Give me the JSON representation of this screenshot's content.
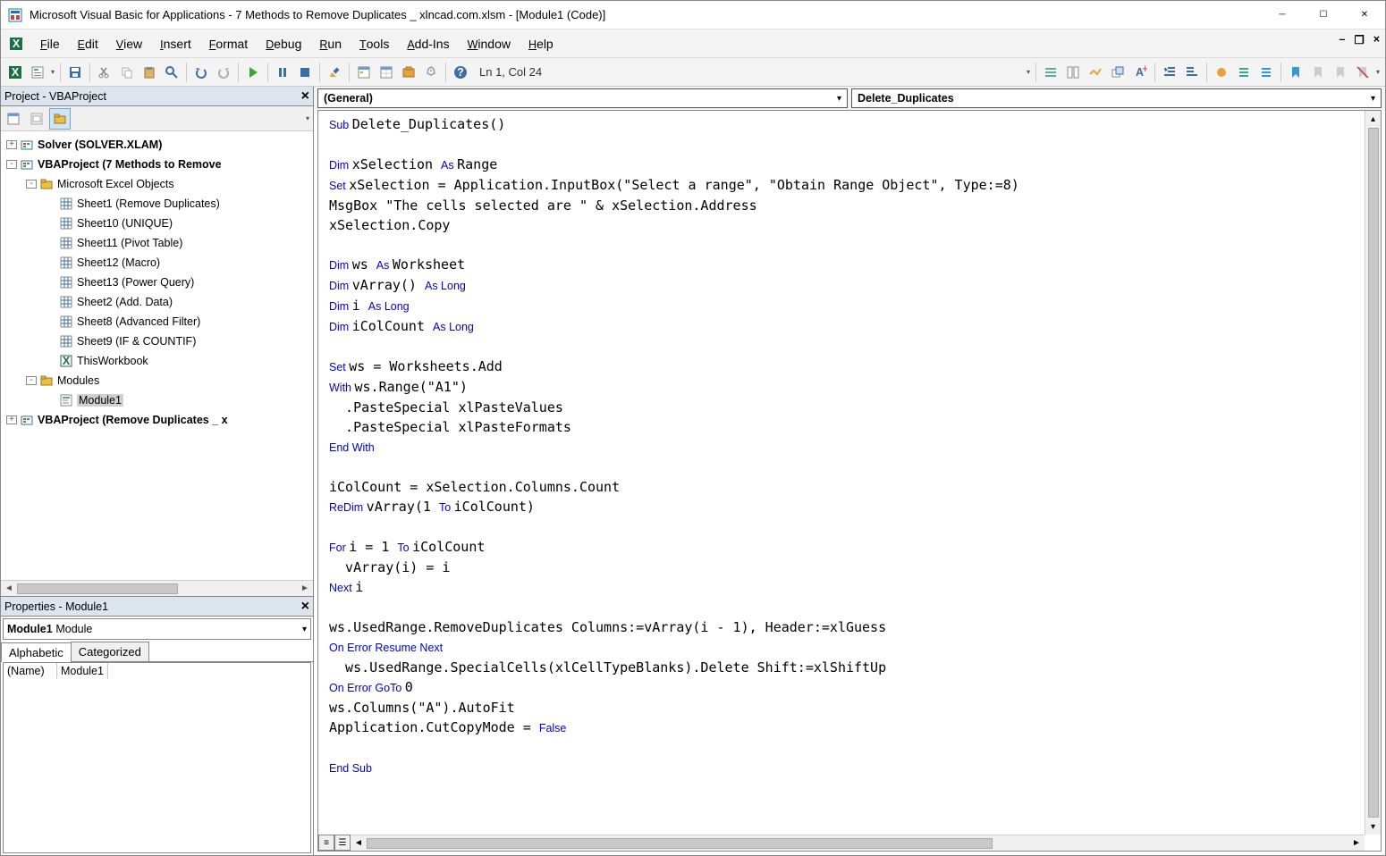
{
  "title": "Microsoft Visual Basic for Applications - 7 Methods to Remove Duplicates _ xlncad.com.xlsm - [Module1 (Code)]",
  "menu": [
    "File",
    "Edit",
    "View",
    "Insert",
    "Format",
    "Debug",
    "Run",
    "Tools",
    "Add-Ins",
    "Window",
    "Help"
  ],
  "status": "Ln 1, Col 24",
  "project": {
    "title": "Project - VBAProject",
    "nodes": [
      {
        "depth": 0,
        "toggle": "+",
        "icon": "proj",
        "label": "Solver (SOLVER.XLAM)",
        "bold": true
      },
      {
        "depth": 0,
        "toggle": "-",
        "icon": "proj",
        "label": "VBAProject (7 Methods to Remove",
        "bold": true
      },
      {
        "depth": 1,
        "toggle": "-",
        "icon": "folder",
        "label": "Microsoft Excel Objects"
      },
      {
        "depth": 2,
        "icon": "sheet",
        "label": "Sheet1 (Remove Duplicates)"
      },
      {
        "depth": 2,
        "icon": "sheet",
        "label": "Sheet10 (UNIQUE)"
      },
      {
        "depth": 2,
        "icon": "sheet",
        "label": "Sheet11 (Pivot Table)"
      },
      {
        "depth": 2,
        "icon": "sheet",
        "label": "Sheet12 (Macro)"
      },
      {
        "depth": 2,
        "icon": "sheet",
        "label": "Sheet13 (Power Query)"
      },
      {
        "depth": 2,
        "icon": "sheet",
        "label": "Sheet2 (Add. Data)"
      },
      {
        "depth": 2,
        "icon": "sheet",
        "label": "Sheet8 (Advanced Filter)"
      },
      {
        "depth": 2,
        "icon": "sheet",
        "label": "Sheet9 (IF & COUNTIF)"
      },
      {
        "depth": 2,
        "icon": "wb",
        "label": "ThisWorkbook"
      },
      {
        "depth": 1,
        "toggle": "-",
        "icon": "folder",
        "label": "Modules"
      },
      {
        "depth": 2,
        "icon": "mod",
        "label": "Module1",
        "selected": true
      },
      {
        "depth": 0,
        "toggle": "+",
        "icon": "proj",
        "label": "VBAProject (Remove Duplicates _ x",
        "bold": true
      }
    ]
  },
  "properties": {
    "title": "Properties - Module1",
    "object_name": "Module1",
    "object_type": "Module",
    "tabs": [
      "Alphabetic",
      "Categorized"
    ],
    "rows": [
      {
        "name": "(Name)",
        "value": "Module1"
      }
    ]
  },
  "combos": {
    "left": "(General)",
    "right": "Delete_Duplicates"
  },
  "code": {
    "tokens": [
      [
        {
          "t": "Sub ",
          "k": 1
        },
        {
          "t": "Delete_Duplicates()"
        }
      ],
      [],
      [
        {
          "t": "Dim ",
          "k": 1
        },
        {
          "t": "xSelection "
        },
        {
          "t": "As ",
          "k": 1
        },
        {
          "t": "Range"
        }
      ],
      [
        {
          "t": "Set ",
          "k": 1
        },
        {
          "t": "xSelection = Application.InputBox(\"Select a range\", \"Obtain Range Object\", Type:=8)"
        }
      ],
      [
        {
          "t": "MsgBox \"The cells selected are \" & xSelection.Address"
        }
      ],
      [
        {
          "t": "xSelection.Copy"
        }
      ],
      [],
      [
        {
          "t": "Dim ",
          "k": 1
        },
        {
          "t": "ws "
        },
        {
          "t": "As ",
          "k": 1
        },
        {
          "t": "Worksheet"
        }
      ],
      [
        {
          "t": "Dim ",
          "k": 1
        },
        {
          "t": "vArray() "
        },
        {
          "t": "As Long",
          "k": 1
        }
      ],
      [
        {
          "t": "Dim ",
          "k": 1
        },
        {
          "t": "i "
        },
        {
          "t": "As Long",
          "k": 1
        }
      ],
      [
        {
          "t": "Dim ",
          "k": 1
        },
        {
          "t": "iColCount "
        },
        {
          "t": "As Long",
          "k": 1
        }
      ],
      [],
      [
        {
          "t": "Set ",
          "k": 1
        },
        {
          "t": "ws = Worksheets.Add"
        }
      ],
      [
        {
          "t": "With ",
          "k": 1
        },
        {
          "t": "ws.Range(\"A1\")"
        }
      ],
      [
        {
          "t": "  .PasteSpecial xlPasteValues"
        }
      ],
      [
        {
          "t": "  .PasteSpecial xlPasteFormats"
        }
      ],
      [
        {
          "t": "End With",
          "k": 1
        }
      ],
      [],
      [
        {
          "t": "iColCount = xSelection.Columns.Count"
        }
      ],
      [
        {
          "t": "ReDim ",
          "k": 1
        },
        {
          "t": "vArray(1 "
        },
        {
          "t": "To ",
          "k": 1
        },
        {
          "t": "iColCount)"
        }
      ],
      [],
      [
        {
          "t": "For ",
          "k": 1
        },
        {
          "t": "i = 1 "
        },
        {
          "t": "To ",
          "k": 1
        },
        {
          "t": "iColCount"
        }
      ],
      [
        {
          "t": "  vArray(i) = i"
        }
      ],
      [
        {
          "t": "Next ",
          "k": 1
        },
        {
          "t": "i"
        }
      ],
      [],
      [
        {
          "t": "ws.UsedRange.RemoveDuplicates Columns:=vArray(i - 1), Header:=xlGuess"
        }
      ],
      [
        {
          "t": "On Error Resume Next",
          "k": 1
        }
      ],
      [
        {
          "t": "  ws.UsedRange.SpecialCells(xlCellTypeBlanks).Delete Shift:=xlShiftUp"
        }
      ],
      [
        {
          "t": "On Error GoTo ",
          "k": 1
        },
        {
          "t": "0"
        }
      ],
      [
        {
          "t": "ws.Columns(\"A\").AutoFit"
        }
      ],
      [
        {
          "t": "Application.CutCopyMode = "
        },
        {
          "t": "False",
          "k": 1
        }
      ],
      [],
      [
        {
          "t": "End Sub",
          "k": 1
        }
      ]
    ]
  }
}
